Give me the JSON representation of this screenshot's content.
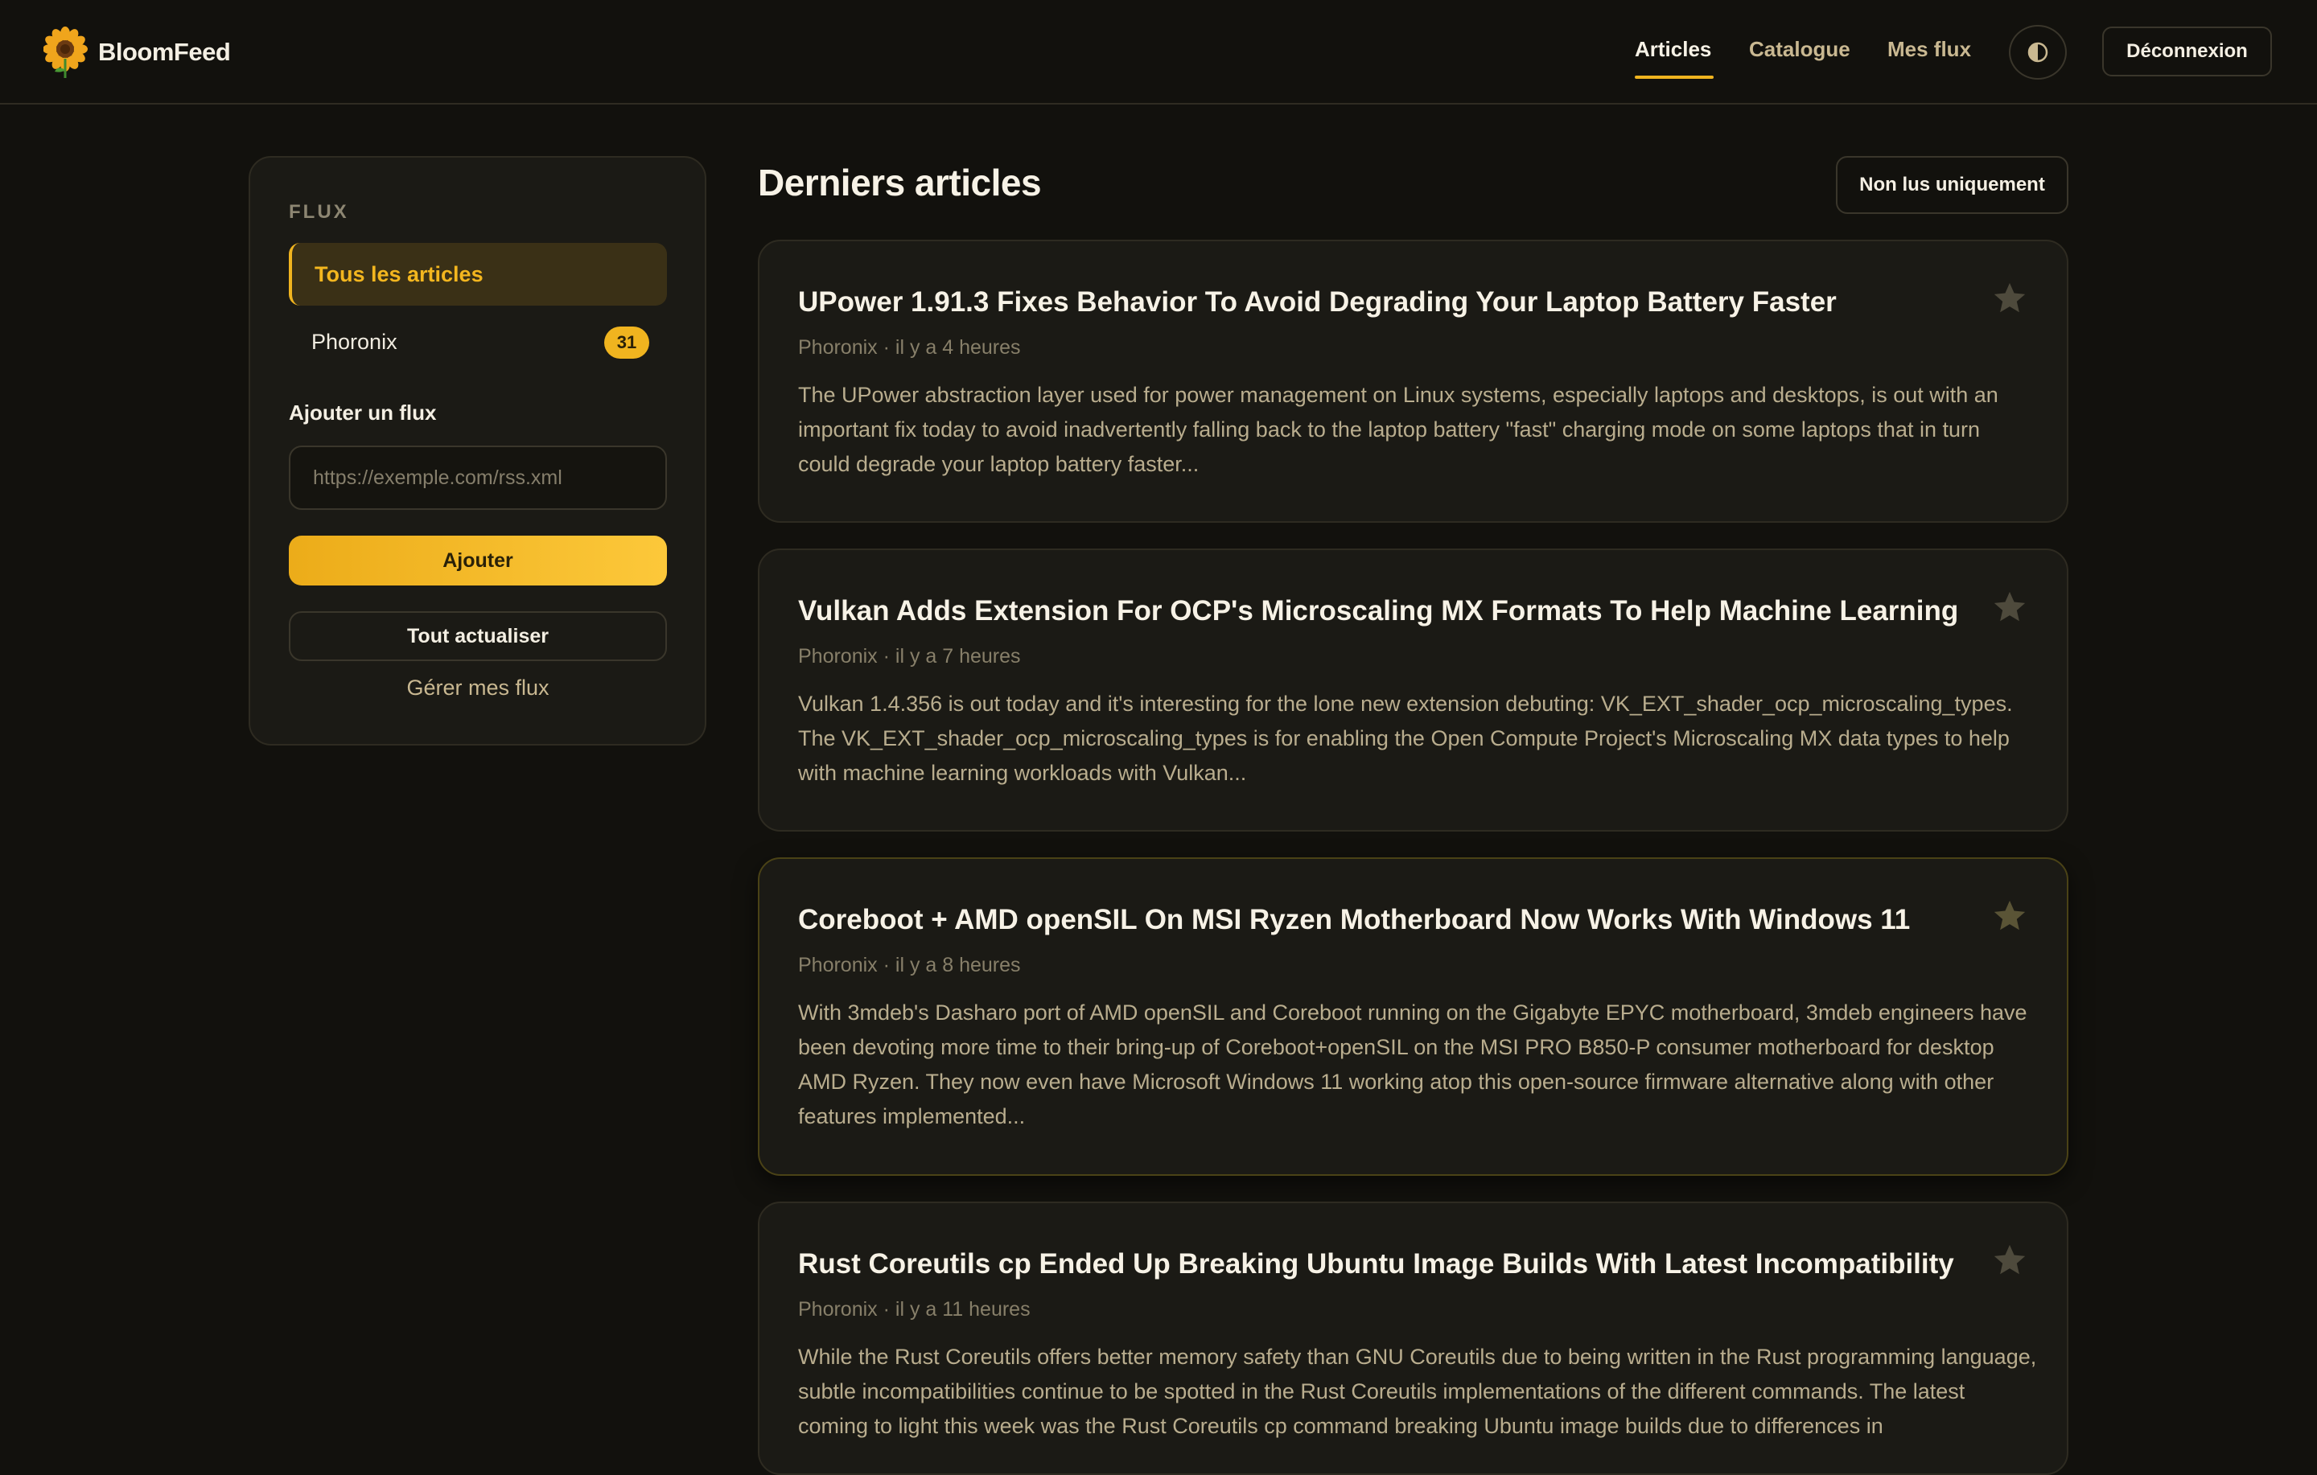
{
  "header": {
    "brand": "BloomFeed",
    "nav": {
      "articles": "Articles",
      "catalogue": "Catalogue",
      "mes_flux": "Mes flux"
    },
    "logout_label": "Déconnexion"
  },
  "sidebar": {
    "heading": "FLUX",
    "feeds": [
      {
        "label": "Tous les articles",
        "active": true
      },
      {
        "label": "Phoronix",
        "count": "31"
      }
    ],
    "add_label": "Ajouter un flux",
    "url_placeholder": "https://exemple.com/rss.xml",
    "url_value": "",
    "add_button": "Ajouter",
    "refresh_button": "Tout actualiser",
    "manage_link": "Gérer mes flux"
  },
  "main": {
    "title": "Derniers articles",
    "filter_button": "Non lus uniquement",
    "articles": [
      {
        "title": "UPower 1.91.3 Fixes Behavior To Avoid Degrading Your Laptop Battery Faster",
        "meta": "Phoronix · il y a 4 heures",
        "excerpt": "The UPower abstraction layer used for power management on Linux systems, especially laptops and desktops, is out with an important fix today to avoid inadvertently falling back to the laptop battery \"fast\" charging mode on some laptops that in turn could degrade your laptop battery faster..."
      },
      {
        "title": "Vulkan Adds Extension For OCP's Microscaling MX Formats To Help Machine Learning",
        "meta": "Phoronix · il y a 7 heures",
        "excerpt": "Vulkan 1.4.356 is out today and it's interesting for the lone new extension debuting: VK_EXT_shader_ocp_microscaling_types. The VK_EXT_shader_ocp_microscaling_types is for enabling the Open Compute Project's Microscaling MX data types to help with machine learning workloads with Vulkan..."
      },
      {
        "title": "Coreboot + AMD openSIL On MSI Ryzen Motherboard Now Works With Windows 11",
        "meta": "Phoronix · il y a 8 heures",
        "excerpt": "With 3mdeb's Dasharo port of AMD openSIL and Coreboot running on the Gigabyte EPYC motherboard, 3mdeb engineers have been devoting more time to their bring-up of Coreboot+openSIL on the MSI PRO B850-P consumer motherboard for desktop AMD Ryzen. They now even have Microsoft Windows 11 working atop this open-source firmware alternative along with other features implemented..."
      },
      {
        "title": "Rust Coreutils cp Ended Up Breaking Ubuntu Image Builds With Latest Incompatibility",
        "meta": "Phoronix · il y a 11 heures",
        "excerpt": "While the Rust Coreutils offers better memory safety than GNU Coreutils due to being written in the Rust programming language, subtle incompatibilities continue to be spotted in the Rust Coreutils implementations of the different commands. The latest coming to light this week was the Rust Coreutils cp command breaking Ubuntu image builds due to differences in"
      }
    ]
  },
  "colors": {
    "background": "#12110d",
    "accent": "#f0b41f",
    "card": "#1b1a15"
  },
  "icons": {
    "logo": "sunflower-logo",
    "theme": "half-circle-contrast-icon",
    "favorite": "star-icon"
  }
}
